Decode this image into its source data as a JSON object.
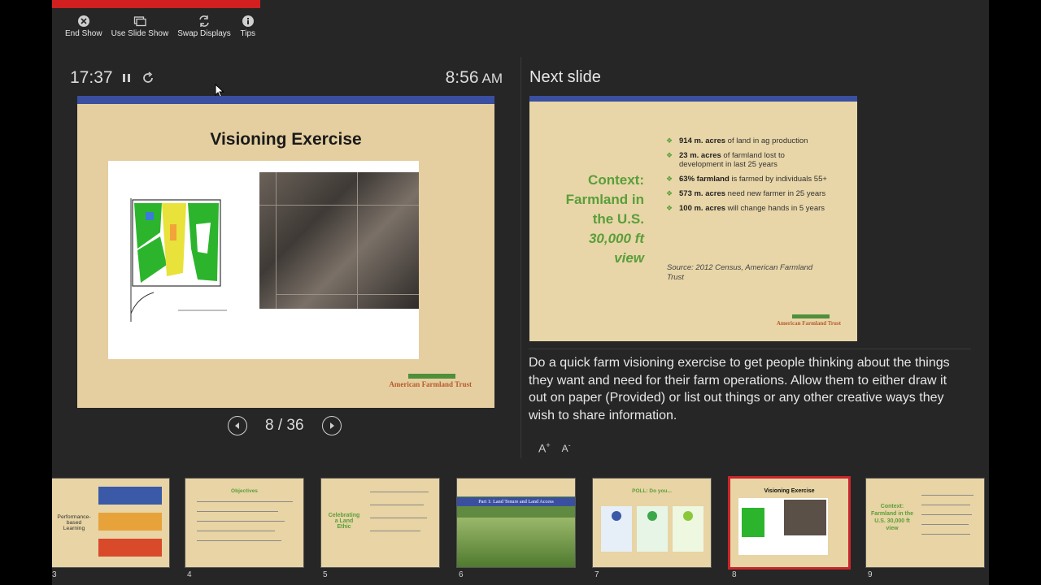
{
  "toolbar": {
    "end_show": "End Show",
    "use_slide_show": "Use Slide Show",
    "swap_displays": "Swap Displays",
    "tips": "Tips"
  },
  "presenter": {
    "elapsed": "17:37",
    "clock_time": "8:56",
    "clock_ampm": "AM",
    "slide_counter": "8 / 36",
    "next_label": "Next slide",
    "notes": "Do a quick farm visioning exercise to get people thinking about the things they want and need for their farm operations. Allow them to either draw it out on paper (Provided) or list out things or any other creative ways they wish to share information."
  },
  "current_slide": {
    "title": "Visioning Exercise",
    "brand": "American Farmland Trust"
  },
  "next_slide": {
    "context_line1": "Context:",
    "context_line2": "Farmland in",
    "context_line3": "the U.S.",
    "context_line4": "30,000 ft",
    "context_line5": "view",
    "bullets": [
      {
        "bold": "914 m. acres",
        "rest": " of land in ag production"
      },
      {
        "bold": "23 m. acres",
        "rest": " of farmland lost to development in last 25 years"
      },
      {
        "bold": "63% farmland",
        "rest": " is farmed by individuals 55+"
      },
      {
        "bold": "573 m. acres",
        "rest": " need new farmer in 25 years"
      },
      {
        "bold": "100 m. acres",
        "rest": " will change hands in 5 years"
      }
    ],
    "source": "Source: 2012 Census, American Farmland Trust",
    "brand": "American Farmland Trust"
  },
  "thumbnails": [
    {
      "num": "3",
      "label": "Performance-based Learning"
    },
    {
      "num": "4",
      "label": "Objectives"
    },
    {
      "num": "5",
      "label": "Celebrating a Land Ethic"
    },
    {
      "num": "6",
      "label": "Part 1: Land Tenure and Land Access"
    },
    {
      "num": "7",
      "label": "POLL: Do you..."
    },
    {
      "num": "8",
      "label": "Visioning Exercise"
    },
    {
      "num": "9",
      "label": "Context: Farmland in the U.S. 30,000 ft view"
    }
  ],
  "colors": {
    "accent_red": "#d21f1f",
    "slide_bg": "#e8d4a4",
    "slide_bar": "#3a4fa0",
    "brand_green": "#5a9e3a"
  }
}
